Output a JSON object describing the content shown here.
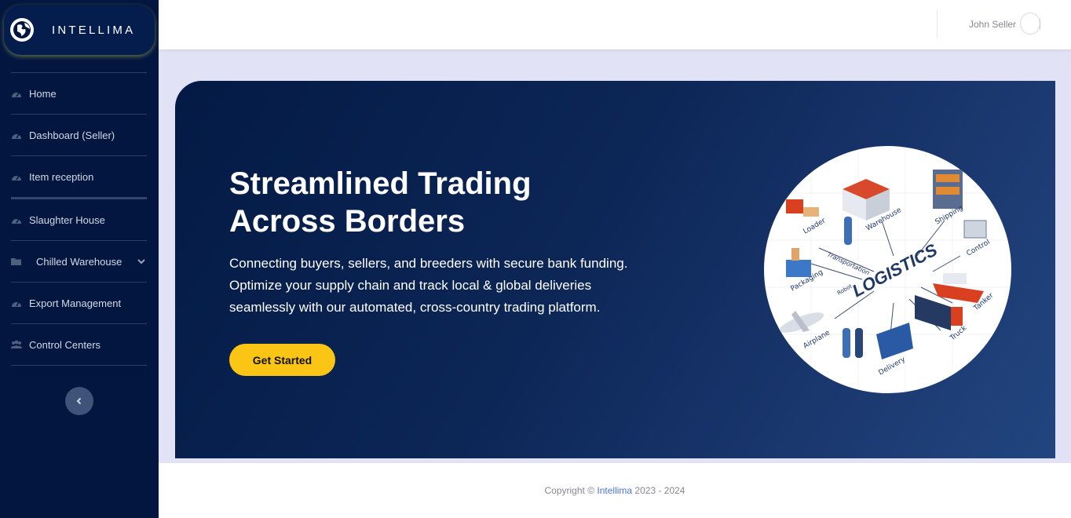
{
  "brand": {
    "name": "INTELLIMA",
    "logo_icon": "globe-icon"
  },
  "sidebar": {
    "items": [
      {
        "label": "Home",
        "icon": "tachometer-icon"
      },
      {
        "label": "Dashboard (Seller)",
        "icon": "tachometer-icon"
      },
      {
        "label": "Item reception",
        "icon": "tachometer-icon"
      },
      {
        "label": "Slaughter House",
        "icon": "tachometer-icon"
      },
      {
        "label": "Chilled Warehouse",
        "icon": "folder-icon",
        "expandable": true
      },
      {
        "label": "Export Management",
        "icon": "tachometer-icon"
      },
      {
        "label": "Control Centers",
        "icon": "users-icon"
      }
    ],
    "collapse_icon": "chevron-left-icon"
  },
  "topbar": {
    "user_name": "John Seller"
  },
  "hero": {
    "title_lines": [
      "Streamlined Trading",
      "Across Borders"
    ],
    "description_lines": [
      "Connecting buyers, sellers, and breeders with secure bank funding.",
      "Optimize your supply chain and track local & global deliveries",
      "seamlessly with our automated, cross-country trading platform."
    ],
    "cta_label": "Get Started",
    "illustration": {
      "center": "LOGISTICS",
      "labels": [
        "Loader",
        "Warehouse",
        "Shipping",
        "Control",
        "Tanker",
        "Truck",
        "Delivery",
        "Airplane",
        "Packaging",
        "Robot",
        "Transportation"
      ]
    }
  },
  "footer": {
    "prefix": "Copyright ©",
    "link": "Intellima",
    "years": "2023 - 2024"
  },
  "colors": {
    "sidebar_bg": "#03163f",
    "hero_start": "#041a45",
    "hero_end": "#22457f",
    "cta": "#fbc515",
    "page_bg": "#e1e2f5",
    "link": "#4e73df"
  }
}
